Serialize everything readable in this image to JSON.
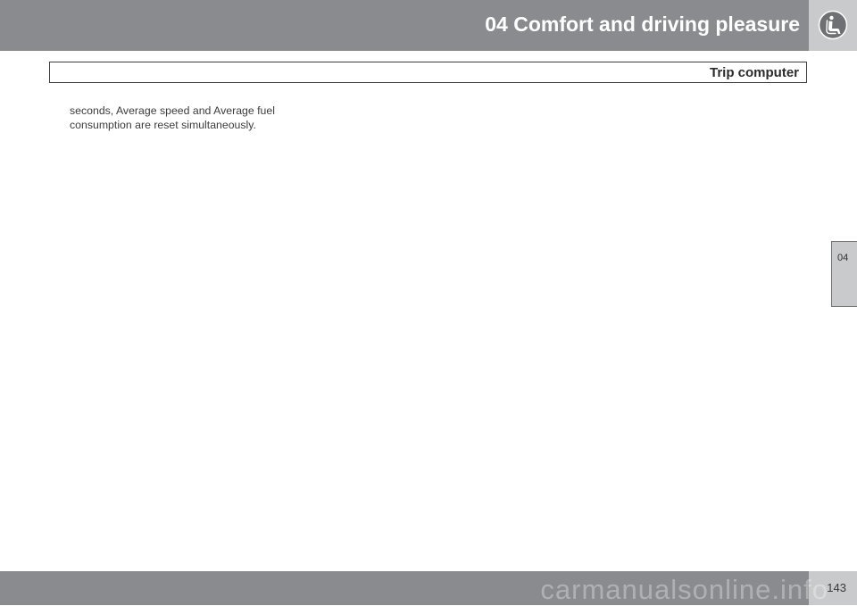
{
  "header": {
    "chapter_title": "04 Comfort and driving pleasure",
    "icon": "seat-icon"
  },
  "section": {
    "title": "Trip computer"
  },
  "content": {
    "paragraph": "seconds, Average speed and Average fuel consumption are reset simultaneously."
  },
  "side_tab": {
    "label": "04"
  },
  "footer": {
    "page_number": "143"
  },
  "watermark": {
    "text": "carmanualsonline.info"
  },
  "colors": {
    "band": "#8a8b8f",
    "tile": "#c9cacc",
    "text": "#3c3c3c"
  }
}
